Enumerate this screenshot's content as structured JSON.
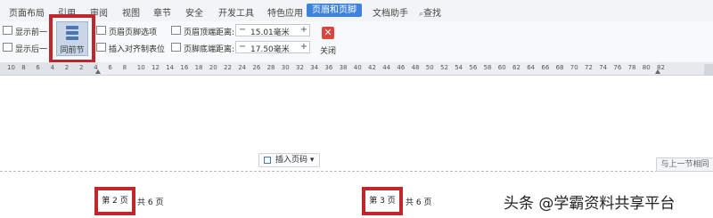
{
  "menu": {
    "items": [
      "页面布局",
      "引用",
      "审阅",
      "视图",
      "章节",
      "安全",
      "开发工具",
      "特色应用"
    ],
    "active": "页眉和页脚",
    "doc_helper": "文档助手",
    "search": "查找"
  },
  "toolbar": {
    "show_prev": "显示前一",
    "show_next": "显示后一",
    "same_as_prev": "同前节",
    "header_footer_options": "页眉页脚选项",
    "insert_align_tab": "插入对齐制表位",
    "header_top_label": "页眉顶端距离:",
    "header_top_value": "15.01毫米",
    "footer_bottom_label": "页脚底端距离:",
    "footer_bottom_value": "17.50毫米",
    "minus": "−",
    "plus": "+",
    "close_label": "关闭",
    "close_glyph": "✕"
  },
  "ruler": {
    "ticks": [
      "10",
      "8",
      "6",
      "4",
      "2",
      "2",
      "4",
      "6",
      "8",
      "10",
      "12",
      "14",
      "16",
      "18",
      "20",
      "22",
      "24",
      "26",
      "28",
      "30",
      "32",
      "34",
      "36",
      "38",
      "40",
      "42",
      "44",
      "46",
      "48",
      "50",
      "52",
      "54",
      "56",
      "58",
      "60",
      "62",
      "64",
      "66",
      "68",
      "70",
      "72",
      "74",
      "76",
      "78",
      "80",
      "82"
    ]
  },
  "page": {
    "insert_page_number": "插入页码",
    "insert_caret": "▾",
    "same_as_previous_tab": "与上一节相同",
    "page_boxes": [
      {
        "label": "第 2 页",
        "total": "共 6 页"
      },
      {
        "label": "第 3 页",
        "total": "共 6 页"
      }
    ]
  },
  "watermark": "头条 @学霸资料共享平台",
  "colors": {
    "accent": "#3d82dd",
    "highlight": "#c0272d",
    "close_red": "#d9453f"
  }
}
